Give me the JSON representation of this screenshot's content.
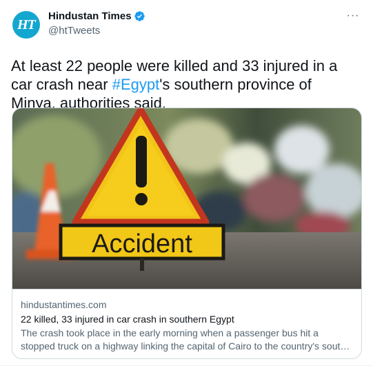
{
  "author": {
    "avatar_text": "HT",
    "display_name": "Hindustan Times",
    "handle": "@htTweets",
    "verified": true,
    "brand_color": "#13a7cf"
  },
  "menu": {
    "more_label": "···"
  },
  "tweet": {
    "text_before": "At least 22 people were killed and 33 injured in a car crash near ",
    "hashtag": "#Egypt",
    "text_after": "'s southern province of Minya, authorities said.",
    "link_color": "#1d9bf0"
  },
  "card": {
    "image_sign_text": "Accident",
    "domain": "hindustantimes.com",
    "title": "22 killed, 33 injured in car crash in southern Egypt",
    "description": "The crash took place in the early morning when a passenger bus hit a stopped truck on a highway linking the capital of Cairo to the country's south, local ..."
  }
}
